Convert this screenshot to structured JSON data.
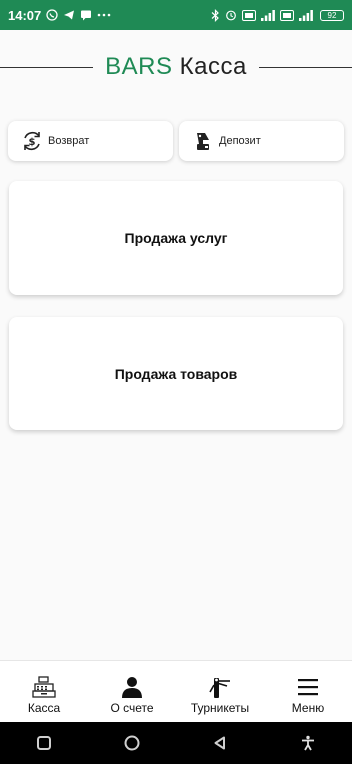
{
  "status_bar": {
    "time": "14:07",
    "battery": "92",
    "icons_left": [
      "whatsapp-icon",
      "telegram-icon",
      "message-icon",
      "more-dots-icon"
    ],
    "icons_right": [
      "bluetooth-icon",
      "alarm-icon",
      "volte-icon",
      "signal-icon",
      "volte-icon",
      "signal-icon",
      "battery-icon"
    ]
  },
  "header": {
    "brand": "BARS",
    "product": "Касса",
    "brand_color": "#1f8a55"
  },
  "quick_actions": {
    "return_label": "Возврат",
    "deposit_label": "Депозит"
  },
  "cards": {
    "services_label": "Продажа услуг",
    "goods_label": "Продажа товаров"
  },
  "bottom_nav": {
    "items": [
      {
        "label": "Касса",
        "icon": "cash-register-icon"
      },
      {
        "label": "О счете",
        "icon": "person-icon"
      },
      {
        "label": "Турникеты",
        "icon": "turnstile-icon"
      },
      {
        "label": "Меню",
        "icon": "hamburger-menu-icon"
      }
    ]
  },
  "system_nav": [
    "square-icon",
    "home-circle-icon",
    "back-triangle-icon",
    "accessibility-icon"
  ],
  "colors": {
    "accent": "#1f8a55",
    "background": "#fafafa",
    "card": "#ffffff"
  }
}
